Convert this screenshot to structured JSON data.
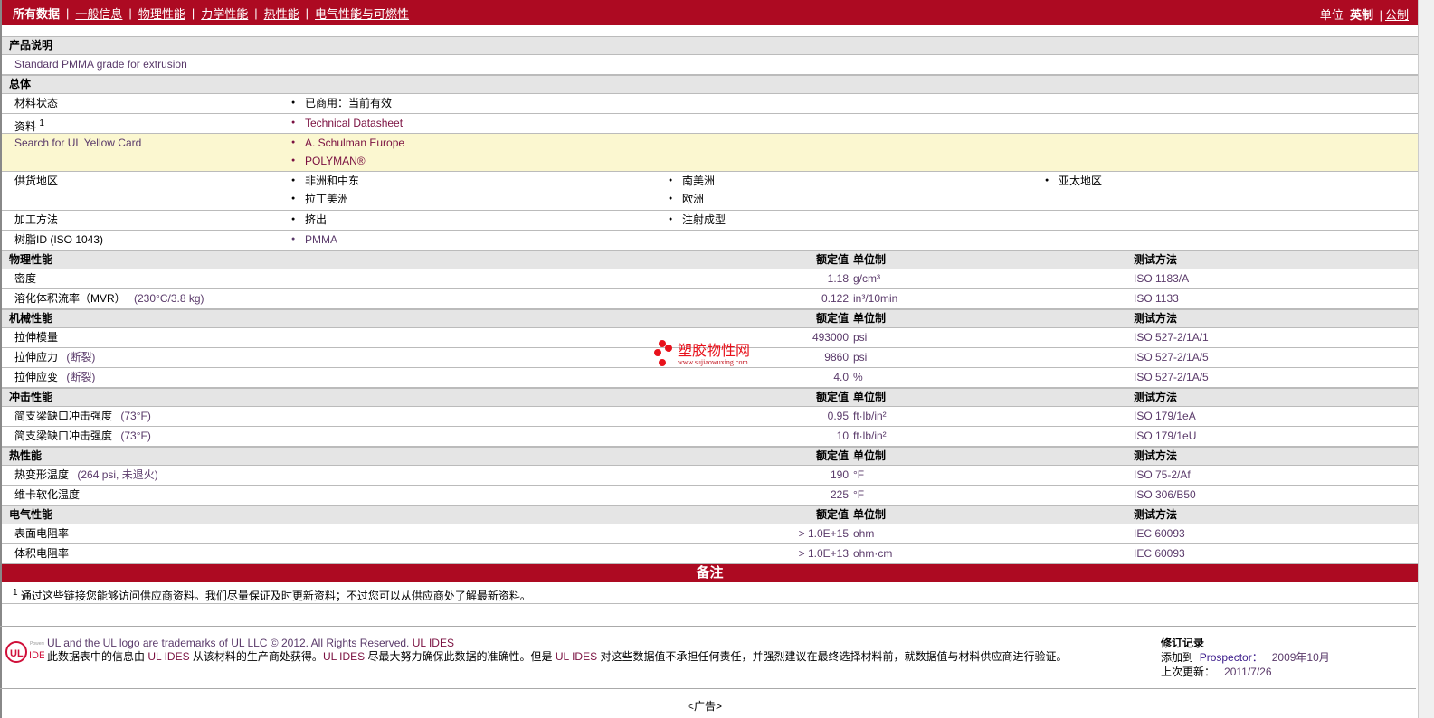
{
  "nav": {
    "items": [
      "所有数据",
      "一般信息",
      "物理性能",
      "力学性能",
      "热性能",
      "电气性能与可燃性"
    ],
    "units_label": "单位",
    "unit_english": "英制",
    "unit_metric": "公制"
  },
  "product_description": {
    "title": "产品说明",
    "text": "Standard PMMA grade for extrusion"
  },
  "general": {
    "title": "总体",
    "material_status": {
      "label": "材料状态",
      "value": "已商用：当前有效"
    },
    "literature": {
      "label": "资料",
      "sup": "1",
      "value": "Technical Datasheet"
    },
    "yellow_card": {
      "label": "Search for UL Yellow Card",
      "values": [
        "A. Schulman Europe",
        "POLYMAN®"
      ]
    },
    "availability": {
      "label": "供货地区",
      "values": [
        "非洲和中东",
        "南美洲",
        "亚太地区",
        "拉丁美洲",
        "欧洲"
      ]
    },
    "processing": {
      "label": "加工方法",
      "values": [
        "挤出",
        "注射成型"
      ]
    },
    "resin_id": {
      "label": "树脂ID (ISO 1043)",
      "value": "PMMA"
    }
  },
  "columns": {
    "nominal": "额定值",
    "unit": "单位制",
    "test": "测试方法"
  },
  "sections": [
    {
      "title": "物理性能",
      "rows": [
        {
          "name": "密度",
          "cond": "",
          "value": "1.18",
          "unit": "g/cm³",
          "test": "ISO 1183/A"
        },
        {
          "name": "溶化体积流率（MVR）",
          "cond": "(230°C/3.8 kg)",
          "value": "0.122",
          "unit": "in³/10min",
          "test": "ISO 1133"
        }
      ]
    },
    {
      "title": "机械性能",
      "rows": [
        {
          "name": "拉伸模量",
          "cond": "",
          "value": "493000",
          "unit": "psi",
          "test": "ISO 527-2/1A/1"
        },
        {
          "name": "拉伸应力",
          "cond": "(断裂)",
          "value": "9860",
          "unit": "psi",
          "test": "ISO 527-2/1A/5"
        },
        {
          "name": "拉伸应变",
          "cond": "(断裂)",
          "value": "4.0",
          "unit": "%",
          "test": "ISO 527-2/1A/5"
        }
      ]
    },
    {
      "title": "冲击性能",
      "rows": [
        {
          "name": "简支梁缺口冲击强度",
          "cond": "(73°F)",
          "value": "0.95",
          "unit": "ft·lb/in²",
          "test": "ISO 179/1eA"
        },
        {
          "name": "简支梁缺口冲击强度",
          "cond": "(73°F)",
          "value": "10",
          "unit": "ft·lb/in²",
          "test": "ISO 179/1eU"
        }
      ]
    },
    {
      "title": "热性能",
      "rows": [
        {
          "name": "热变形温度",
          "cond": "(264 psi, 未退火)",
          "value": "190",
          "unit": "°F",
          "test": "ISO 75-2/Af"
        },
        {
          "name": "维卡软化温度",
          "cond": "",
          "value": "225",
          "unit": "°F",
          "test": "ISO 306/B50"
        }
      ]
    },
    {
      "title": "电气性能",
      "rows": [
        {
          "name": "表面电阻率",
          "cond": "",
          "value": "> 1.0E+15",
          "unit": "ohm",
          "test": "IEC 60093"
        },
        {
          "name": "体积电阻率",
          "cond": "",
          "value": "> 1.0E+13",
          "unit": "ohm·cm",
          "test": "IEC 60093"
        }
      ]
    }
  ],
  "notes": {
    "title": "备注",
    "sup": "1",
    "text": "通过这些链接您能够访问供应商资料。我们尽量保证及时更新资料；不过您可以从供应商处了解最新资料。"
  },
  "footer": {
    "logo_text": "Powered by UL IDES",
    "line1": "UL and the UL logo are trademarks of UL LLC © 2012. All Rights Reserved.",
    "line1_link": "UL IDES",
    "p1": "此数据表中的信息由 ",
    "l1": "UL IDES",
    "p2": " 从该材料的生产商处获得。",
    "l2": "UL IDES",
    "p3": " 尽最大努力确保此数据的准确性。但是 ",
    "l3": "UL IDES",
    "p4": " 对这些数据值不承担任何责任，并强烈建议在最终选择材料前，就数据值与材料供应商进行验证。",
    "rev_title": "修订记录",
    "added_label": "添加到",
    "prospector": "Prospector：",
    "added_date": "2009年10月",
    "updated_label": "上次更新：",
    "updated_date": "2011/7/26"
  },
  "ad": "<广告>",
  "watermark": {
    "name": "塑胶物性网",
    "url": "www.sujiaowuxing.com"
  }
}
